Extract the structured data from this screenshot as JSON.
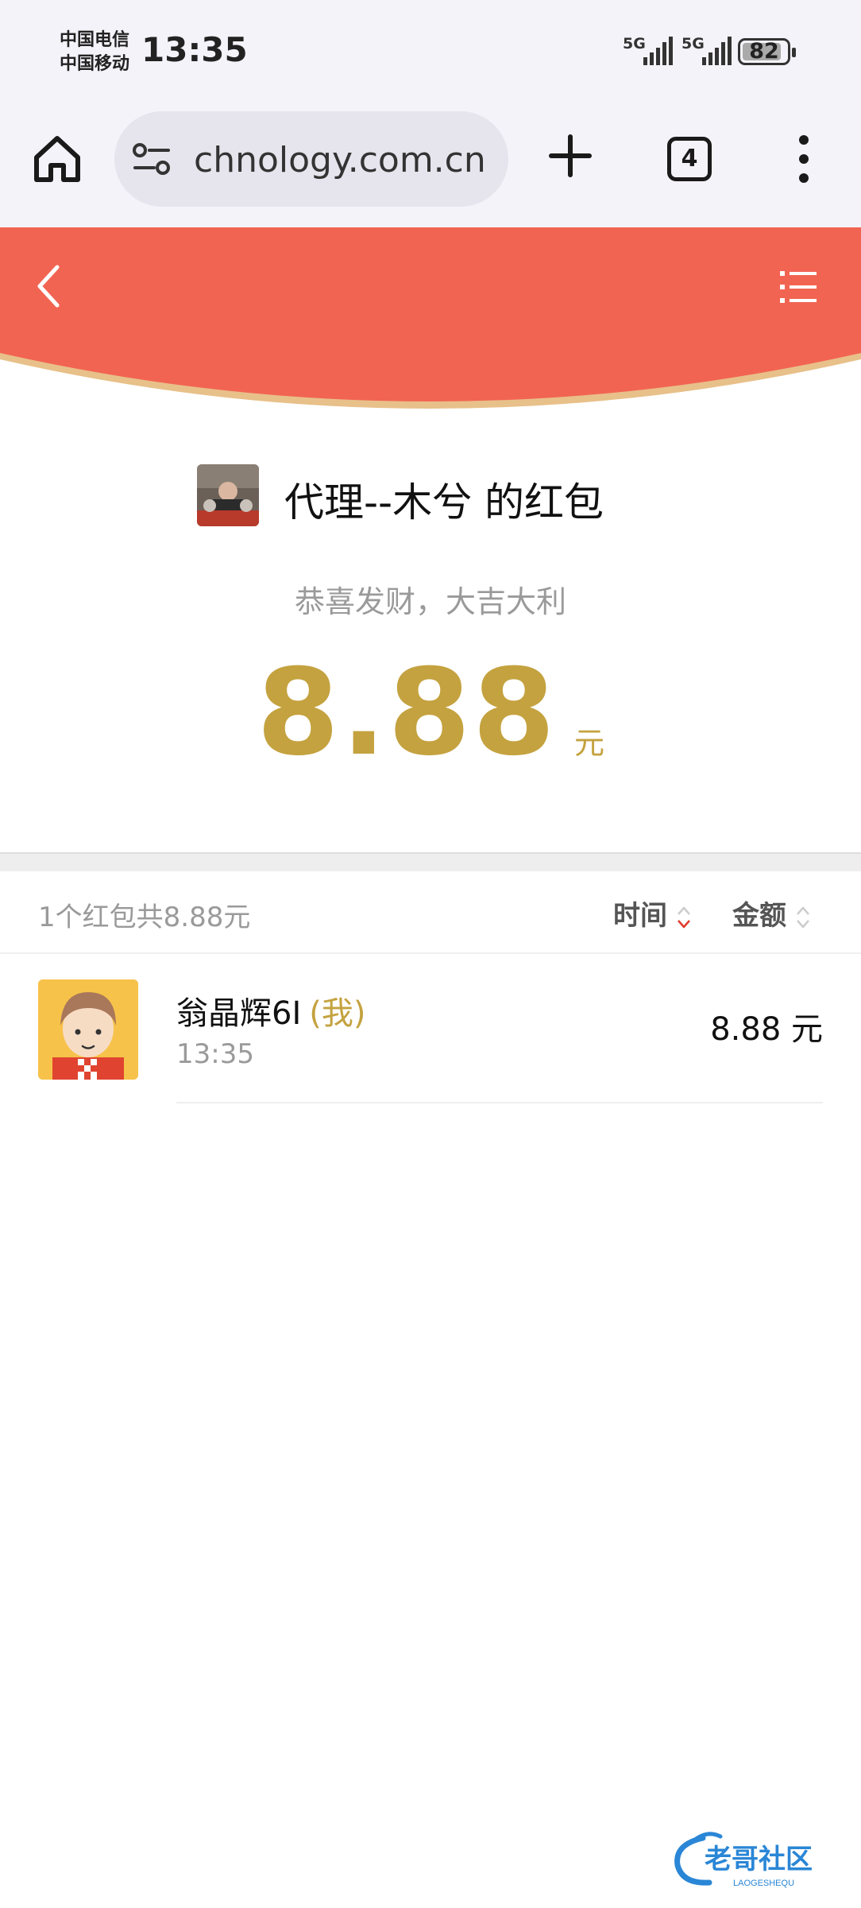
{
  "status": {
    "carrier1": "中国电信",
    "carrier2": "中国移动",
    "time": "13:35",
    "sim1": "5G",
    "sim2": "5G",
    "battery": "82"
  },
  "browser": {
    "url": "chnology.com.cn",
    "tab_count": "4"
  },
  "hongbao": {
    "sender_name": "代理--木兮 的红包",
    "wish": "恭喜发财，大吉大利",
    "amount": "8.88",
    "unit": "元",
    "header_color": "#f26452",
    "amount_color": "#c4a23f"
  },
  "summary": {
    "text": "1个红包共8.88元",
    "sort_time": "时间",
    "sort_amount": "金额"
  },
  "records": [
    {
      "name": "翁晶辉6I",
      "me_tag": "(我)",
      "time": "13:35",
      "amount": "8.88 元"
    }
  ],
  "watermark": {
    "text": "老哥社区",
    "subtext": "LAOGESHEQU"
  }
}
